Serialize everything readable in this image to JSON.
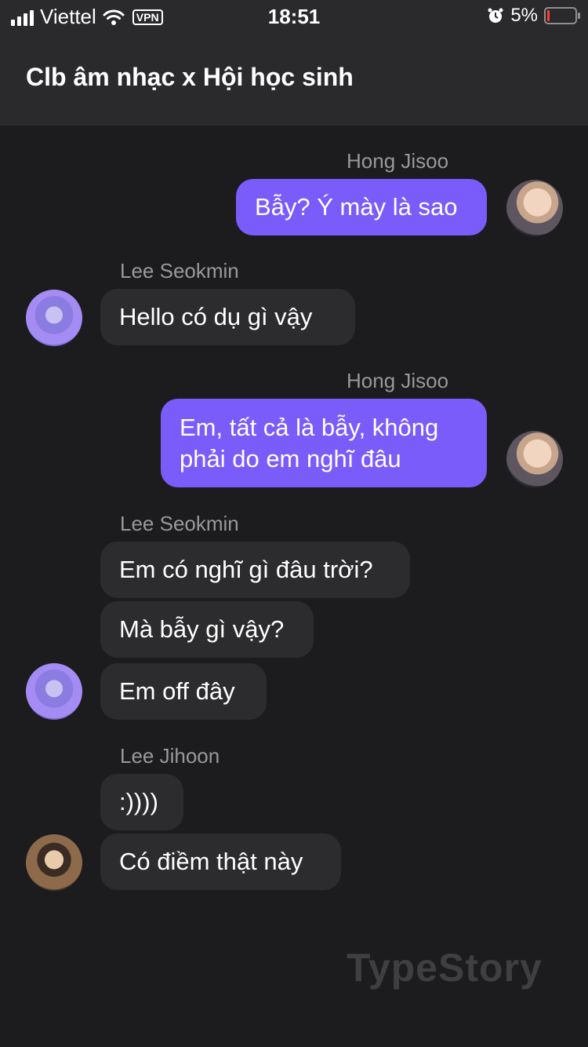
{
  "status_bar": {
    "carrier": "Viettel",
    "vpn": "VPN",
    "time": "18:51",
    "battery": "5%"
  },
  "header": {
    "title": "Clb âm nhạc x Hội học sinh"
  },
  "messages": [
    {
      "sender": "Hong Jisoo",
      "text": "Bẫy? Ý mày là sao"
    },
    {
      "sender": "Lee Seokmin",
      "text": "Hello có dụ gì vậy"
    },
    {
      "sender": "Hong Jisoo",
      "text": "Em, tất cả là bẫy, không phải do em nghĩ đâu"
    },
    {
      "sender": "Lee Seokmin",
      "texts": [
        "Em có nghĩ gì đâu trời?",
        "Mà bẫy gì vậy?",
        "Em off đây"
      ]
    },
    {
      "sender": "Lee Jihoon",
      "texts": [
        ":))))",
        "Có điềm thật này"
      ]
    }
  ],
  "watermark": "TypeStory",
  "icons": {
    "signal": "signal-icon",
    "wifi": "wifi-icon",
    "alarm": "alarm-icon",
    "battery": "battery-icon"
  },
  "colors": {
    "outgoing_bubble": "#7a5cfa",
    "incoming_bubble": "#2c2c2e",
    "background": "#1c1c1e"
  }
}
